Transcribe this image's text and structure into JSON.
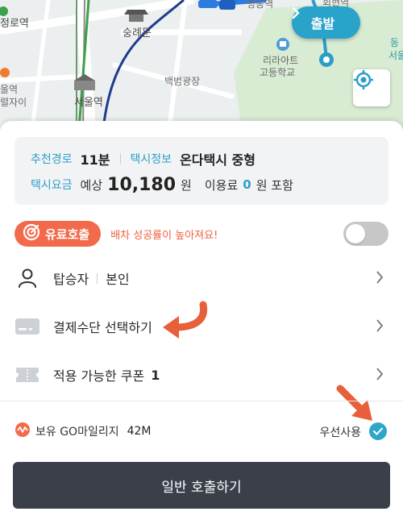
{
  "map": {
    "labels": {
      "jeongno": "정로역",
      "sungnyemun": "숭례문",
      "seoul_station": "서울역",
      "baekbeom": "백범광장",
      "lila_art": "리라아트",
      "highschool": "고등학교",
      "top_station": "명동역",
      "seoul_station_left": "울역",
      "left_partial": "렬자이",
      "right_partial_1": "동",
      "right_partial_2": "서울",
      "top_right_partial": "회현역"
    },
    "depart_label": "출발",
    "icons": {
      "depart": "chevron-right-icon",
      "locate": "my-location-icon",
      "school": "school-icon"
    }
  },
  "trip_info": {
    "route_label": "추천경로",
    "route_value": "11분",
    "taxi_label": "택시정보",
    "taxi_value": "온다택시 중형",
    "fare_label": "택시요금",
    "fare_prefix": "예상",
    "fare_amount": "10,180",
    "fare_unit": "원",
    "fee_label": "이용료",
    "fee_amount": "0",
    "fee_suffix": "원 포함"
  },
  "premium": {
    "label": "유료호출",
    "hint": "배차 성공률이 높아져요!",
    "enabled": false,
    "icon": "target-icon"
  },
  "menu": {
    "passenger_label": "탑승자",
    "passenger_value": "본인",
    "payment_label": "결제수단 선택하기",
    "coupon_label": "적용 가능한 쿠폰",
    "coupon_count": "1"
  },
  "mileage": {
    "label": "보유 GO마일리지",
    "value": "42M",
    "prefer_label": "우선사용",
    "prefer_checked": true
  },
  "call_button": "일반 호출하기",
  "colors": {
    "accent_blue": "#2f9fc9",
    "accent_orange": "#f26a4b",
    "button_dark": "#3a3f4a"
  }
}
